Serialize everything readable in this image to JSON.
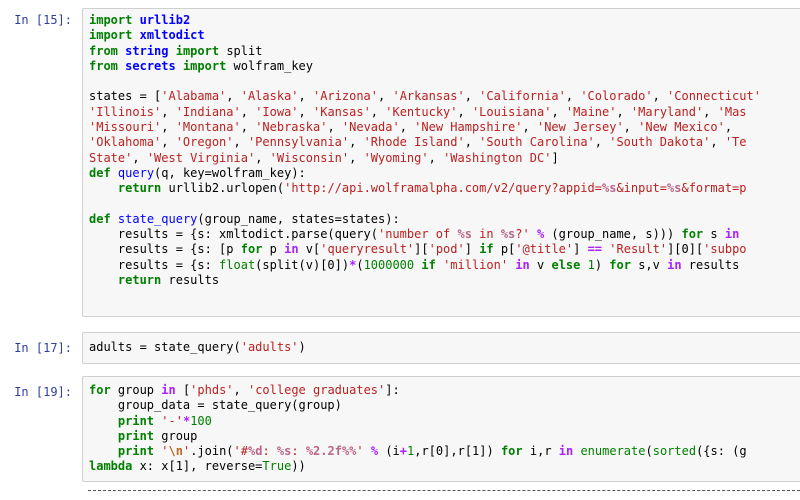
{
  "cells": [
    {
      "prompt": "In [15]:",
      "lines": [
        [
          [
            "kw",
            "import"
          ],
          [
            "sp",
            " "
          ],
          [
            "mod",
            "urllib2"
          ]
        ],
        [
          [
            "kw",
            "import"
          ],
          [
            "sp",
            " "
          ],
          [
            "mod",
            "xmltodict"
          ]
        ],
        [
          [
            "kw",
            "from"
          ],
          [
            "sp",
            " "
          ],
          [
            "mod",
            "string"
          ],
          [
            "sp",
            " "
          ],
          [
            "kw",
            "import"
          ],
          [
            "sp",
            " split"
          ]
        ],
        [
          [
            "kw",
            "from"
          ],
          [
            "sp",
            " "
          ],
          [
            "mod",
            "secrets"
          ],
          [
            "sp",
            " "
          ],
          [
            "kw",
            "import"
          ],
          [
            "sp",
            " wolfram_key"
          ]
        ],
        [
          [
            "sp",
            ""
          ]
        ],
        [
          [
            "sp",
            "states = ["
          ],
          [
            "str",
            "'Alabama'"
          ],
          [
            "sp",
            ", "
          ],
          [
            "str",
            "'Alaska'"
          ],
          [
            "sp",
            ", "
          ],
          [
            "str",
            "'Arizona'"
          ],
          [
            "sp",
            ", "
          ],
          [
            "str",
            "'Arkansas'"
          ],
          [
            "sp",
            ", "
          ],
          [
            "str",
            "'California'"
          ],
          [
            "sp",
            ", "
          ],
          [
            "str",
            "'Colorado'"
          ],
          [
            "sp",
            ", "
          ],
          [
            "str",
            "'Connecticut'"
          ]
        ],
        [
          [
            "str",
            "'Illinois'"
          ],
          [
            "sp",
            ", "
          ],
          [
            "str",
            "'Indiana'"
          ],
          [
            "sp",
            ", "
          ],
          [
            "str",
            "'Iowa'"
          ],
          [
            "sp",
            ", "
          ],
          [
            "str",
            "'Kansas'"
          ],
          [
            "sp",
            ", "
          ],
          [
            "str",
            "'Kentucky'"
          ],
          [
            "sp",
            ", "
          ],
          [
            "str",
            "'Louisiana'"
          ],
          [
            "sp",
            ", "
          ],
          [
            "str",
            "'Maine'"
          ],
          [
            "sp",
            ", "
          ],
          [
            "str",
            "'Maryland'"
          ],
          [
            "sp",
            ", "
          ],
          [
            "str",
            "'Mas"
          ]
        ],
        [
          [
            "str",
            "'Missouri'"
          ],
          [
            "sp",
            ", "
          ],
          [
            "str",
            "'Montana'"
          ],
          [
            "sp",
            ", "
          ],
          [
            "str",
            "'Nebraska'"
          ],
          [
            "sp",
            ", "
          ],
          [
            "str",
            "'Nevada'"
          ],
          [
            "sp",
            ", "
          ],
          [
            "str",
            "'New Hampshire'"
          ],
          [
            "sp",
            ", "
          ],
          [
            "str",
            "'New Jersey'"
          ],
          [
            "sp",
            ", "
          ],
          [
            "str",
            "'New Mexico'"
          ],
          [
            "sp",
            ", "
          ]
        ],
        [
          [
            "str",
            "'Oklahoma'"
          ],
          [
            "sp",
            ", "
          ],
          [
            "str",
            "'Oregon'"
          ],
          [
            "sp",
            ", "
          ],
          [
            "str",
            "'Pennsylvania'"
          ],
          [
            "sp",
            ", "
          ],
          [
            "str",
            "'Rhode Island'"
          ],
          [
            "sp",
            ", "
          ],
          [
            "str",
            "'South Carolina'"
          ],
          [
            "sp",
            ", "
          ],
          [
            "str",
            "'South Dakota'"
          ],
          [
            "sp",
            ", "
          ],
          [
            "str",
            "'Te"
          ]
        ],
        [
          [
            "str",
            "State'"
          ],
          [
            "sp",
            ", "
          ],
          [
            "str",
            "'West Virginia'"
          ],
          [
            "sp",
            ", "
          ],
          [
            "str",
            "'Wisconsin'"
          ],
          [
            "sp",
            ", "
          ],
          [
            "str",
            "'Wyoming'"
          ],
          [
            "sp",
            ", "
          ],
          [
            "str",
            "'Washington DC'"
          ],
          [
            "sp",
            "]"
          ]
        ],
        [
          [
            "kw",
            "def"
          ],
          [
            "sp",
            " "
          ],
          [
            "def",
            "query"
          ],
          [
            "sp",
            "(q, key=wolfram_key):"
          ]
        ],
        [
          [
            "sp",
            "    "
          ],
          [
            "kw",
            "return"
          ],
          [
            "sp",
            " urllib2.urlopen("
          ],
          [
            "str",
            "'http://api.wolframalpha.com/v2/query?appid="
          ],
          [
            "int",
            "%s"
          ],
          [
            "str",
            "&input="
          ],
          [
            "int",
            "%s"
          ],
          [
            "str",
            "&format=p"
          ]
        ],
        [
          [
            "sp",
            ""
          ]
        ],
        [
          [
            "kw",
            "def"
          ],
          [
            "sp",
            " "
          ],
          [
            "def",
            "state_query"
          ],
          [
            "sp",
            "(group_name, states=states):"
          ]
        ],
        [
          [
            "sp",
            "    results = {s: xmltodict.parse(query("
          ],
          [
            "str",
            "'number of "
          ],
          [
            "int",
            "%s"
          ],
          [
            "str",
            " in "
          ],
          [
            "int",
            "%s"
          ],
          [
            "str",
            "?'"
          ],
          [
            "sp",
            " "
          ],
          [
            "op",
            "%"
          ],
          [
            "sp",
            " (group_name, s))) "
          ],
          [
            "kw",
            "for"
          ],
          [
            "sp",
            " s "
          ],
          [
            "op",
            "in"
          ]
        ],
        [
          [
            "sp",
            "    results = {s: [p "
          ],
          [
            "kw",
            "for"
          ],
          [
            "sp",
            " p "
          ],
          [
            "op",
            "in"
          ],
          [
            "sp",
            " v["
          ],
          [
            "str",
            "'queryresult'"
          ],
          [
            "sp",
            "]["
          ],
          [
            "str",
            "'pod'"
          ],
          [
            "sp",
            "] "
          ],
          [
            "kw",
            "if"
          ],
          [
            "sp",
            " p["
          ],
          [
            "str",
            "'@title'"
          ],
          [
            "sp",
            "] "
          ],
          [
            "op",
            "=="
          ],
          [
            "sp",
            " "
          ],
          [
            "str",
            "'Result'"
          ],
          [
            "sp",
            "][0]["
          ],
          [
            "str",
            "'subpo"
          ]
        ],
        [
          [
            "sp",
            "    results = {s: "
          ],
          [
            "bi",
            "float"
          ],
          [
            "sp",
            "(split(v)[0])"
          ],
          [
            "op",
            "*"
          ],
          [
            "sp",
            "("
          ],
          [
            "num",
            "1000000"
          ],
          [
            "sp",
            " "
          ],
          [
            "kw",
            "if"
          ],
          [
            "sp",
            " "
          ],
          [
            "str",
            "'million'"
          ],
          [
            "sp",
            " "
          ],
          [
            "op",
            "in"
          ],
          [
            "sp",
            " v "
          ],
          [
            "kw",
            "else"
          ],
          [
            "sp",
            " "
          ],
          [
            "num",
            "1"
          ],
          [
            "sp",
            ") "
          ],
          [
            "kw",
            "for"
          ],
          [
            "sp",
            " s,v "
          ],
          [
            "op",
            "in"
          ],
          [
            "sp",
            " results"
          ]
        ],
        [
          [
            "sp",
            "    "
          ],
          [
            "kw",
            "return"
          ],
          [
            "sp",
            " results"
          ]
        ],
        [
          [
            "sp",
            ""
          ]
        ]
      ]
    },
    {
      "prompt": "In [17]:",
      "lines": [
        [
          [
            "sp",
            "adults = state_query("
          ],
          [
            "str",
            "'adults'"
          ],
          [
            "sp",
            ")"
          ]
        ]
      ]
    },
    {
      "prompt": "In [19]:",
      "lines": [
        [
          [
            "kw",
            "for"
          ],
          [
            "sp",
            " group "
          ],
          [
            "op",
            "in"
          ],
          [
            "sp",
            " ["
          ],
          [
            "str",
            "'phds'"
          ],
          [
            "sp",
            ", "
          ],
          [
            "str",
            "'college graduates'"
          ],
          [
            "sp",
            "]:"
          ]
        ],
        [
          [
            "sp",
            "    group_data = state_query(group)"
          ]
        ],
        [
          [
            "sp",
            "    "
          ],
          [
            "kw",
            "print"
          ],
          [
            "sp",
            " "
          ],
          [
            "str",
            "'-'"
          ],
          [
            "op",
            "*"
          ],
          [
            "num",
            "100"
          ]
        ],
        [
          [
            "sp",
            "    "
          ],
          [
            "kw",
            "print"
          ],
          [
            "sp",
            " group"
          ]
        ],
        [
          [
            "sp",
            "    "
          ],
          [
            "kw",
            "print"
          ],
          [
            "sp",
            " "
          ],
          [
            "str",
            "'"
          ],
          [
            "esc",
            "\\n"
          ],
          [
            "str",
            "'"
          ],
          [
            "sp",
            ".join("
          ],
          [
            "str",
            "'#"
          ],
          [
            "int",
            "%d"
          ],
          [
            "str",
            ": "
          ],
          [
            "int",
            "%s"
          ],
          [
            "str",
            ": "
          ],
          [
            "int",
            "%2.2f"
          ],
          [
            "int",
            "%%"
          ],
          [
            "str",
            "'"
          ],
          [
            "sp",
            " "
          ],
          [
            "op",
            "%"
          ],
          [
            "sp",
            " (i"
          ],
          [
            "op",
            "+"
          ],
          [
            "num",
            "1"
          ],
          [
            "sp",
            ",r[0],r[1]) "
          ],
          [
            "kw",
            "for"
          ],
          [
            "sp",
            " i,r "
          ],
          [
            "op",
            "in"
          ],
          [
            "sp",
            " "
          ],
          [
            "bi",
            "enumerate"
          ],
          [
            "sp",
            "("
          ],
          [
            "bi",
            "sorted"
          ],
          [
            "sp",
            "({s: (g"
          ]
        ],
        [
          [
            "kw",
            "lambda"
          ],
          [
            "sp",
            " x: x[1], reverse="
          ],
          [
            "bi",
            "True"
          ],
          [
            "sp",
            "))"
          ]
        ]
      ]
    }
  ]
}
